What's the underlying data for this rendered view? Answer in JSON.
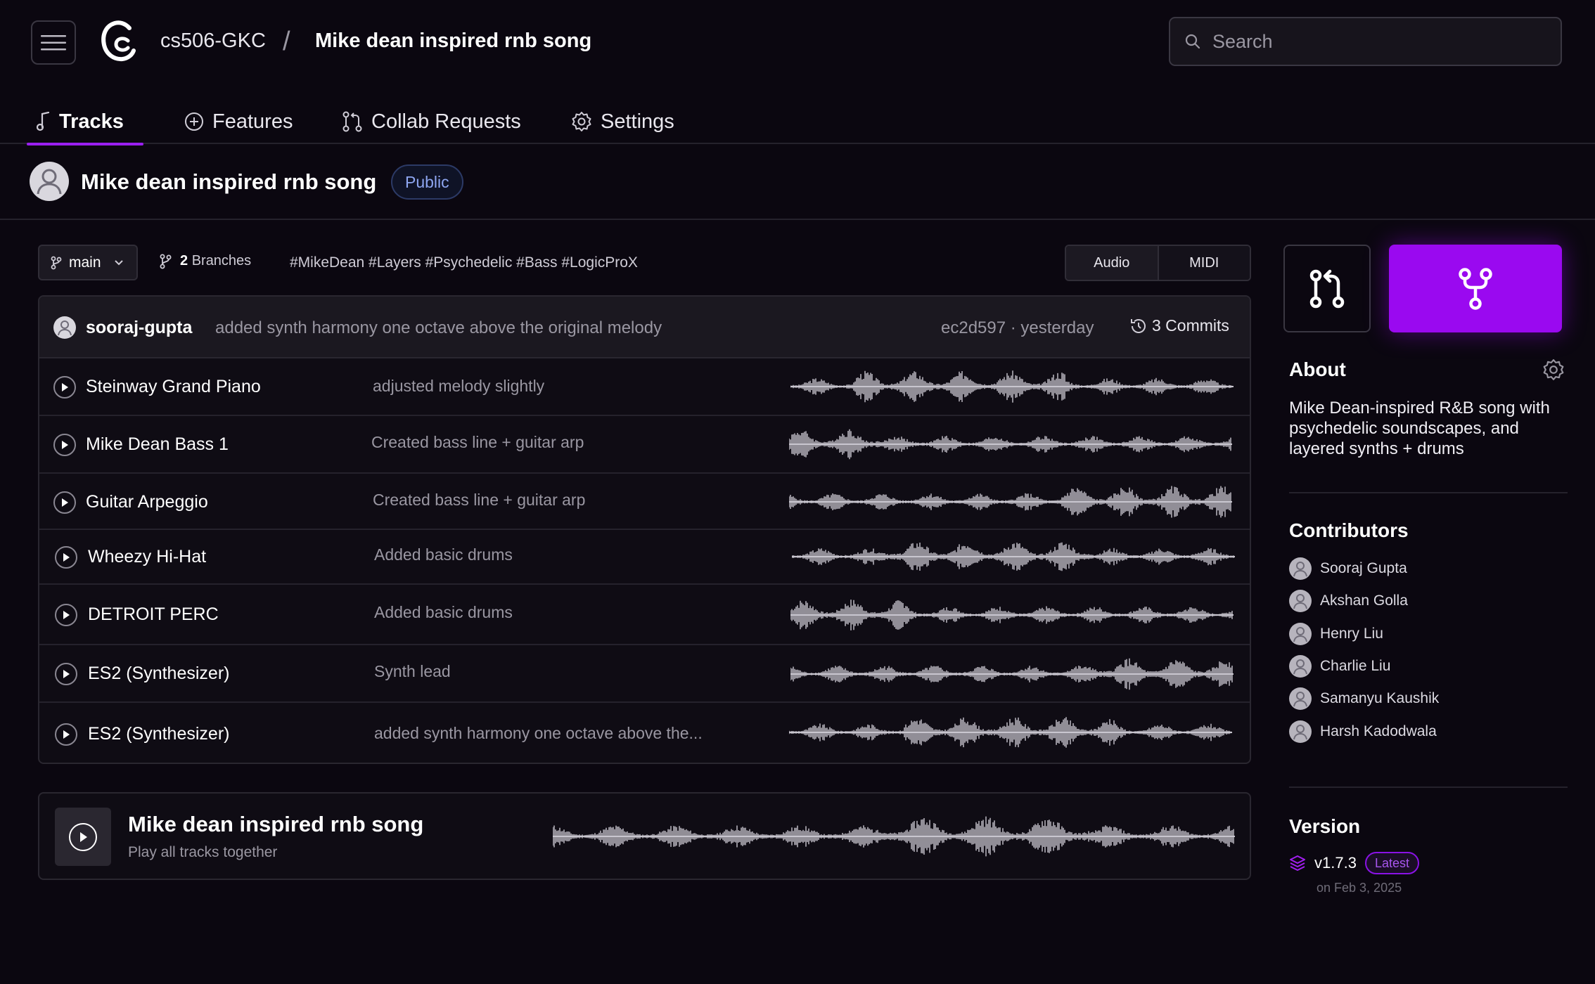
{
  "header": {
    "org": "cs506-GKC",
    "separator": "/",
    "repo": "Mike dean inspired rnb song",
    "search_placeholder": "Search"
  },
  "tabs": [
    {
      "label": "Tracks",
      "icon": "music-note-icon",
      "active": true
    },
    {
      "label": "Features",
      "icon": "plus-circle-icon"
    },
    {
      "label": "Collab Requests",
      "icon": "pull-request-icon"
    },
    {
      "label": "Settings",
      "icon": "gear-icon"
    }
  ],
  "repo_bar": {
    "title": "Mike dean inspired rnb song",
    "visibility": "Public"
  },
  "toolbar": {
    "branch": "main",
    "branches_count": "2",
    "branches_label": "Branches",
    "tags": "#MikeDean #Layers #Psychedelic #Bass #LogicProX",
    "view_options": [
      "Audio",
      "MIDI"
    ]
  },
  "commit": {
    "user": "sooraj-gupta",
    "message": "added synth harmony one octave above the original melody",
    "hash_time": "ec2d597 · yesterday",
    "commits_label": "3 Commits"
  },
  "tracks": [
    {
      "name": "Steinway Grand Piano",
      "message": "adjusted melody slightly"
    },
    {
      "name": "Mike Dean Bass 1",
      "message": "Created bass line + guitar arp"
    },
    {
      "name": "Guitar Arpeggio",
      "message": "Created bass line + guitar arp"
    },
    {
      "name": "Wheezy Hi-Hat",
      "message": "Added basic drums"
    },
    {
      "name": "DETROIT PERC",
      "message": "Added basic drums"
    },
    {
      "name": "ES2 (Synthesizer)",
      "message": "Synth lead"
    },
    {
      "name": "ES2 (Synthesizer)",
      "message": "added synth harmony one octave above the..."
    }
  ],
  "play_all": {
    "title": "Mike dean inspired rnb song",
    "subtitle": "Play all tracks together"
  },
  "sidebar": {
    "about_heading": "About",
    "about_text": "Mike Dean-inspired R&B song with psychedelic soundscapes, and layered synths + drums",
    "contributors_heading": "Contributors",
    "contributors": [
      "Sooraj Gupta",
      "Akshan Golla",
      "Henry Liu",
      "Charlie Liu",
      "Samanyu Kaushik",
      "Harsh Kadodwala"
    ],
    "version_heading": "Version",
    "version": "v1.7.3",
    "version_badge": "Latest",
    "version_date": "on Feb 3, 2025"
  },
  "colors": {
    "background": "#0b0710",
    "accent": "#9a09f0",
    "public_badge": "#8ea6f0",
    "waveform": "#c9c6cf"
  }
}
